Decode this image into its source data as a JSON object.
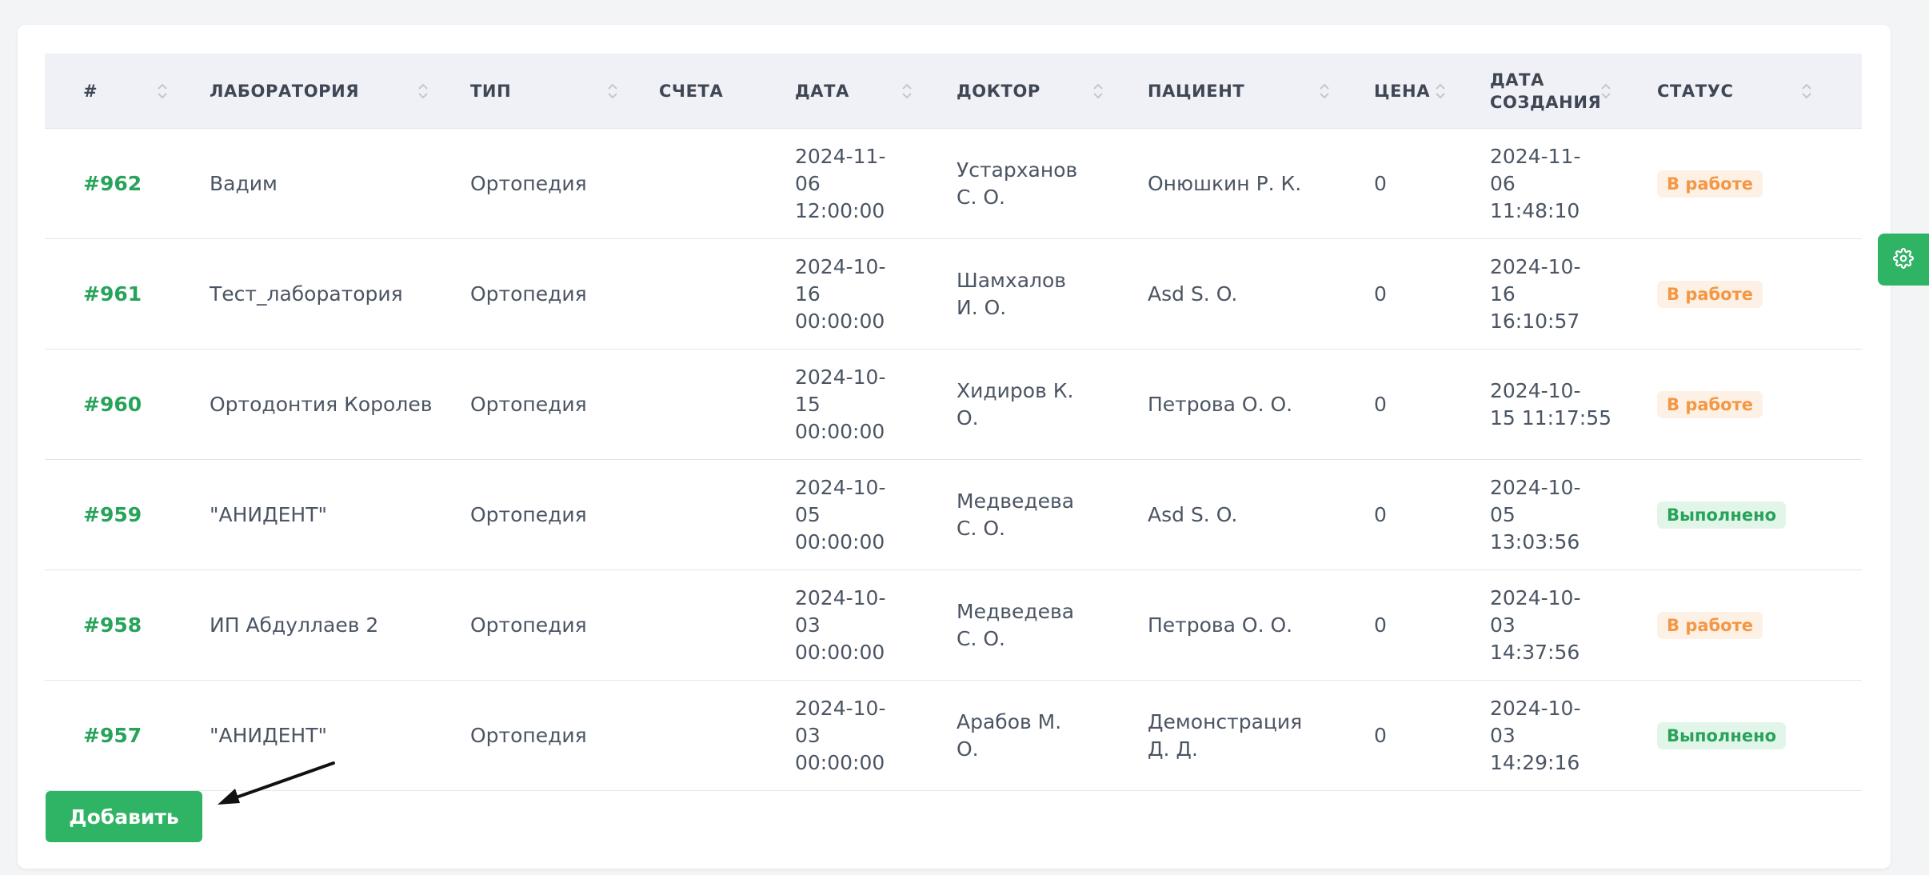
{
  "table": {
    "headers": [
      "#",
      "ЛАБОРАТОРИЯ",
      "ТИП",
      "СЧЕТА",
      "ДАТА",
      "ДОКТОР",
      "ПАЦИЕНТ",
      "ЦЕНА",
      "ДАТА СОЗДАНИЯ",
      "СТАТУС"
    ],
    "header_date_created_line1": "ДАТА",
    "header_date_created_line2": "СОЗДАНИЯ",
    "rows": [
      {
        "id": "#962",
        "lab": "Вадим",
        "type": "Ортопедия",
        "invoices": "",
        "date_l1": "2024-11-",
        "date_l2": "06",
        "date_l3": "12:00:00",
        "doctor_l1": "Устарханов",
        "doctor_l2": "С. О.",
        "patient_l1": "Онюшкин Р. К.",
        "patient_l2": "",
        "price": "0",
        "created_l1": "2024-11-",
        "created_l2": "06",
        "created_l3": "11:48:10",
        "status": "В работе"
      },
      {
        "id": "#961",
        "lab": "Тест_лаборатория",
        "type": "Ортопедия",
        "invoices": "",
        "date_l1": "2024-10-",
        "date_l2": "16",
        "date_l3": "00:00:00",
        "doctor_l1": "Шамхалов",
        "doctor_l2": "И. О.",
        "patient_l1": "Asd S. O.",
        "patient_l2": "",
        "price": "0",
        "created_l1": "2024-10-",
        "created_l2": "16",
        "created_l3": "16:10:57",
        "status": "В работе"
      },
      {
        "id": "#960",
        "lab": "Ортодонтия Королев",
        "type": "Ортопедия",
        "invoices": "",
        "date_l1": "2024-10-",
        "date_l2": "15",
        "date_l3": "00:00:00",
        "doctor_l1": "Хидиров К.",
        "doctor_l2": "О.",
        "patient_l1": "Петрова О. О.",
        "patient_l2": "",
        "price": "0",
        "created_l1": "2024-10-",
        "created_l2": "15 11:17:55",
        "created_l3": "",
        "status": "В работе"
      },
      {
        "id": "#959",
        "lab": "\"АНИДЕНТ\"",
        "type": "Ортопедия",
        "invoices": "",
        "date_l1": "2024-10-",
        "date_l2": "05",
        "date_l3": "00:00:00",
        "doctor_l1": "Медведева",
        "doctor_l2": "С. О.",
        "patient_l1": "Asd S. O.",
        "patient_l2": "",
        "price": "0",
        "created_l1": "2024-10-",
        "created_l2": "05",
        "created_l3": "13:03:56",
        "status": "Выполнено"
      },
      {
        "id": "#958",
        "lab": "ИП Абдуллаев 2",
        "type": "Ортопедия",
        "invoices": "",
        "date_l1": "2024-10-",
        "date_l2": "03",
        "date_l3": "00:00:00",
        "doctor_l1": "Медведева",
        "doctor_l2": "С. О.",
        "patient_l1": "Петрова О. О.",
        "patient_l2": "",
        "price": "0",
        "created_l1": "2024-10-",
        "created_l2": "03",
        "created_l3": "14:37:56",
        "status": "В работе"
      },
      {
        "id": "#957",
        "lab": "\"АНИДЕНТ\"",
        "type": "Ортопедия",
        "invoices": "",
        "date_l1": "2024-10-",
        "date_l2": "03",
        "date_l3": "00:00:00",
        "doctor_l1": "Арабов М.",
        "doctor_l2": "О.",
        "patient_l1": "Демонстрация",
        "patient_l2": "Д. Д.",
        "price": "0",
        "created_l1": "2024-10-",
        "created_l2": "03",
        "created_l3": "14:29:16",
        "status": "Выполнено"
      }
    ]
  },
  "add_button": {
    "label": "Добавить"
  },
  "colors": {
    "accent": "#2fb365",
    "status_work": "#f49744",
    "status_done": "#27a35a"
  },
  "icons": {
    "settings_tab": "gear-icon",
    "sort": "sort-icon",
    "annotation": "arrow-icon"
  }
}
